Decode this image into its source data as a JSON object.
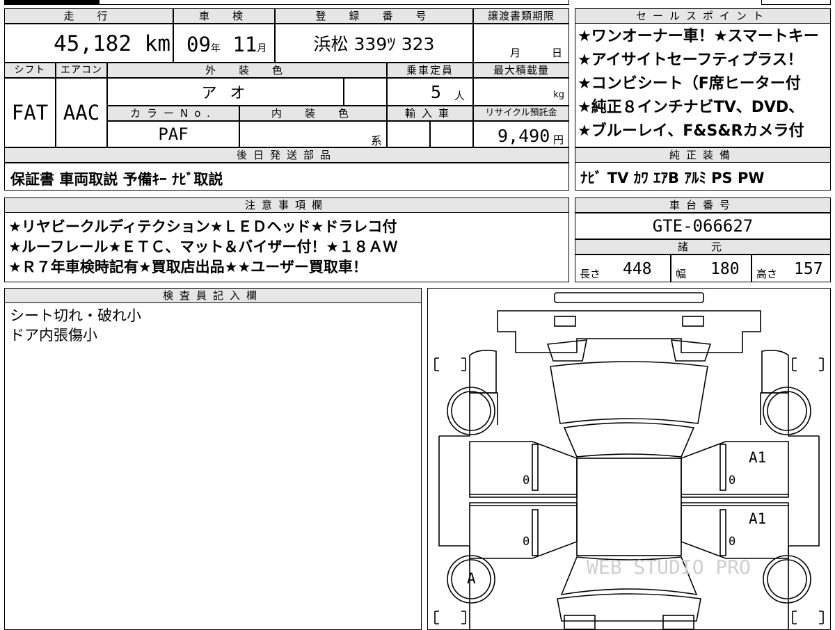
{
  "mileage": {
    "header": "走　行",
    "value": "45,182",
    "unit": "km"
  },
  "inspection": {
    "header": "車　検",
    "year": "09",
    "year_unit": "年",
    "month": "11",
    "month_unit": "月"
  },
  "registration": {
    "header": "登　録　番　号",
    "value": "浜松 339ﾂ 323"
  },
  "transfer_deadline": {
    "header": "譲渡書類期限",
    "month_unit": "月",
    "day_unit": "日"
  },
  "sales_points": {
    "header": "セールスポイント",
    "lines": [
      "★ワンオーナー車！★スマートキー",
      "★アイサイトセーフティプラス！",
      "★コンビシート（F席ヒーター付",
      "★純正８インチナビTV、DVD、",
      "★ブルーレイ、F&S&Rカメラ付"
    ]
  },
  "shift": {
    "header": "シフト",
    "value": "FAT"
  },
  "aircon": {
    "header": "エアコン",
    "value": "AAC"
  },
  "exterior_color": {
    "header": "外　装　色",
    "value": "ア オ"
  },
  "capacity": {
    "header": "乗車定員",
    "value": "5",
    "unit": "人"
  },
  "max_load": {
    "header": "最大積載量",
    "unit": "kg"
  },
  "color_no": {
    "header": "カラーNo.",
    "value": "PAF"
  },
  "interior_color": {
    "header": "内　装　色",
    "suffix": "系"
  },
  "imported": {
    "header": "輸入車"
  },
  "recycle": {
    "header": "リサイクル預託金",
    "value": "9,490",
    "unit": "円"
  },
  "later_parts": {
    "header": "後日発送部品",
    "value": "保証書 車両取説 予備ｷｰ ﾅﾋﾞ取説"
  },
  "genuine_equipment": {
    "header": "純正装備",
    "value": "ﾅﾋﾞ TV ｶﾜ ｴｱB ｱﾙﾐ PS PW"
  },
  "notes": {
    "header": "注意事項欄",
    "lines": [
      "★リヤビークルディテクション★ＬＥＤヘッド★ドラレコ付",
      "★ルーフレール★ＥＴＣ、マット＆バイザー付！★１８ＡＷ",
      "★Ｒ７年車検時記有★買取店出品★★ユーザー買取車！"
    ]
  },
  "chassis": {
    "header": "車台番号",
    "value": "GTE-066627"
  },
  "specs": {
    "header": "諸　元",
    "length_label": "長さ",
    "length": "448",
    "width_label": "幅",
    "width": "180",
    "height_label": "高さ",
    "height": "157"
  },
  "inspector": {
    "header": "検査員記入欄",
    "lines": [
      "シート切れ・破れ小",
      "ドア内張傷小"
    ]
  },
  "diagram": {
    "marks": {
      "rear_right_door": "A1",
      "front_right_door": "A1",
      "front_left_wheel": "A",
      "left_rear_door_zero": "0",
      "left_front_door_zero": "0",
      "right_rear_door_zero": "0",
      "right_front_door_zero": "0"
    },
    "watermark": "WEB STUDIO PRO"
  }
}
